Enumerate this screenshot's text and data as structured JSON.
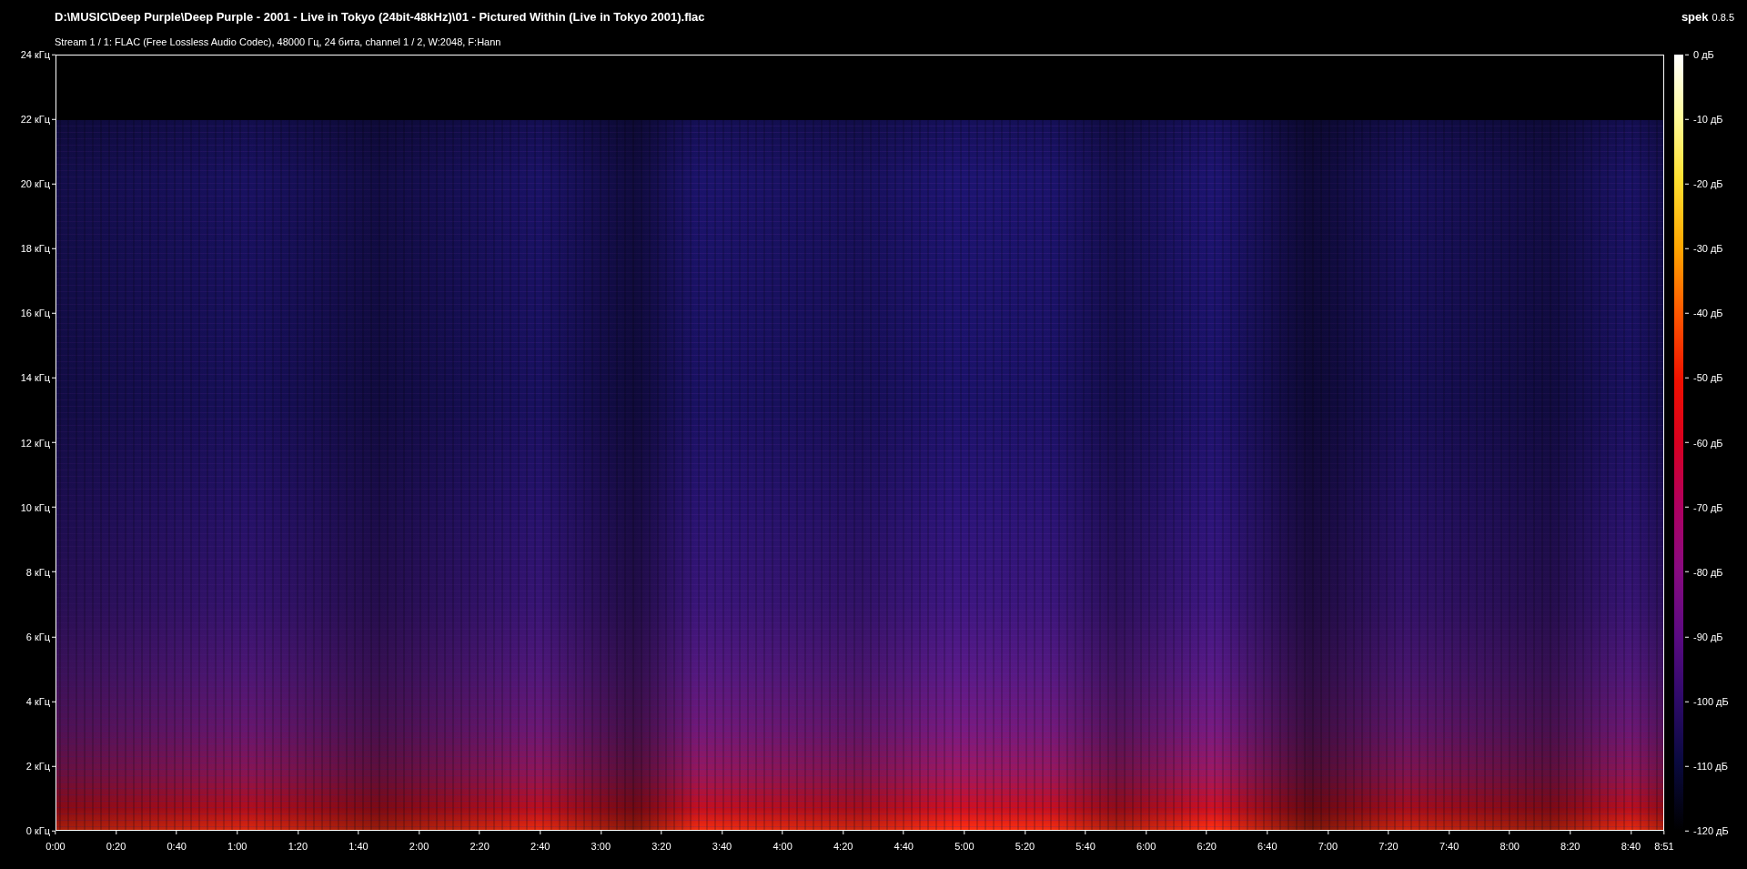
{
  "header": {
    "file_path": "D:\\MUSIC\\Deep Purple\\Deep Purple - 2001 - Live in Tokyo (24bit-48kHz)\\01 - Pictured Within (Live in Tokyo 2001).flac",
    "stream_info": "Stream 1 / 1: FLAC (Free Lossless Audio Codec), 48000 Гц, 24 бита, channel 1 / 2, W:2048, F:Hann"
  },
  "app": {
    "name": "spek",
    "version": "0.8.5"
  },
  "frequency_axis": {
    "ticks": [
      "24 кГц",
      "22 кГц",
      "20 кГц",
      "18 кГц",
      "16 кГц",
      "14 кГц",
      "12 кГц",
      "10 кГц",
      "8 кГц",
      "6 кГц",
      "4 кГц",
      "2 кГц",
      "0 кГц"
    ]
  },
  "time_axis": {
    "ticks": [
      "0:00",
      "0:20",
      "0:40",
      "1:00",
      "1:20",
      "1:40",
      "2:00",
      "2:20",
      "2:40",
      "3:00",
      "3:20",
      "3:40",
      "4:00",
      "4:20",
      "4:40",
      "5:00",
      "5:20",
      "5:40",
      "6:00",
      "6:20",
      "6:40",
      "7:00",
      "7:20",
      "7:40",
      "8:00",
      "8:20",
      "8:40",
      "8:51"
    ]
  },
  "color_scale": {
    "ticks": [
      "0 дБ",
      "-10 дБ",
      "-20 дБ",
      "-30 дБ",
      "-40 дБ",
      "-50 дБ",
      "-60 дБ",
      "-70 дБ",
      "-80 дБ",
      "-90 дБ",
      "-100 дБ",
      "-110 дБ",
      "-120 дБ"
    ]
  }
}
